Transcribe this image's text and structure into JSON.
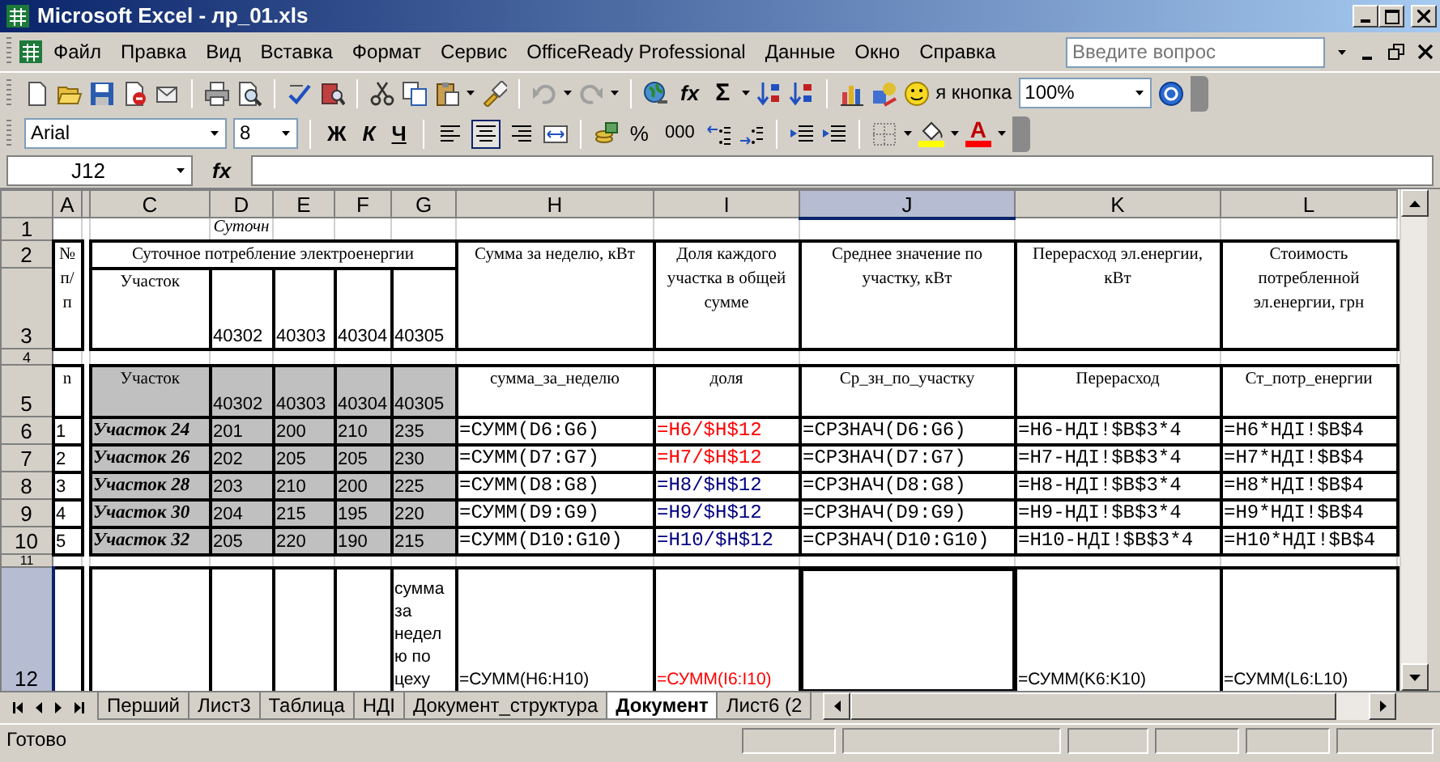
{
  "window": {
    "title": "Microsoft Excel - лр_01.xls"
  },
  "menu": [
    "Файл",
    "Правка",
    "Вид",
    "Вставка",
    "Формат",
    "Сервис",
    "OfficeReady Professional",
    "Данные",
    "Окно",
    "Справка"
  ],
  "help_search": {
    "placeholder": "Введите вопрос"
  },
  "standard_toolbar": {
    "function": "fx",
    "autosum": "Σ",
    "custom_button": "я кнопка",
    "zoom": "100%"
  },
  "formatting_toolbar": {
    "font": "Arial",
    "size": "8",
    "buttons": [
      {
        "label": "Ж",
        "kind": "bold"
      },
      {
        "label": "К",
        "kind": "italic"
      },
      {
        "label": "Ч",
        "kind": "underline"
      }
    ],
    "alignment": [
      {
        "kind": "left",
        "selected": false
      },
      {
        "kind": "center",
        "selected": true
      },
      {
        "kind": "right",
        "selected": false
      }
    ],
    "percent": "%",
    "thousands": "000",
    "font_color": "A"
  },
  "formula_bar": {
    "name_box": "J12",
    "fx": "fx"
  },
  "columns": [
    {
      "label": "A",
      "selected": false
    },
    {
      "selected": false
    },
    {
      "label": "C",
      "selected": false
    },
    {
      "label": "D",
      "selected": false
    },
    {
      "label": "E",
      "selected": false
    },
    {
      "label": "F",
      "selected": false
    },
    {
      "label": "G",
      "selected": false
    },
    {
      "label": "H",
      "selected": false
    },
    {
      "label": "I",
      "selected": false
    },
    {
      "label": "J",
      "selected": true
    },
    {
      "label": "K",
      "selected": false
    },
    {
      "label": "L",
      "selected": false
    }
  ],
  "rows": [
    {
      "header": "1",
      "selected": false,
      "cells": {
        "D": {
          "text": "Суточн",
          "kind": "caption",
          "italic": true
        }
      }
    },
    {
      "header": "2",
      "selected": false,
      "cells": {
        "A": {
          "text": "№ п/п",
          "kind": "caption"
        },
        "C": {
          "text": "Суточное потребление электроенергии",
          "kind": "caption"
        },
        "H": {
          "text": "Сумма за неделю, кВт",
          "kind": "caption"
        },
        "I": {
          "text": "Доля каждого участка в общей сумме",
          "kind": "caption"
        },
        "J": {
          "text": "Среднее значение по участку,  кВт",
          "kind": "caption"
        },
        "K": {
          "text": "Перерасход эл.енергии, кВт",
          "kind": "caption"
        },
        "L": {
          "text": "Стоимость потребленной эл.енергии, грн",
          "kind": "caption"
        }
      }
    },
    {
      "header": "3",
      "selected": false,
      "cells": {
        "C": {
          "text": "Участок",
          "kind": "caption"
        },
        "D": {
          "text": "40302",
          "kind": "number"
        },
        "E": {
          "text": "40303",
          "kind": "number"
        },
        "F": {
          "text": "40304",
          "kind": "number"
        },
        "G": {
          "text": "40305",
          "kind": "number"
        }
      }
    },
    {
      "header": "4",
      "selected": false
    },
    {
      "header": "5",
      "selected": false,
      "cells": {
        "A": {
          "text": "n",
          "kind": "caption",
          "shaded": false
        },
        "C": {
          "text": "Участок",
          "kind": "caption",
          "shaded": true
        },
        "D": {
          "text": "40302",
          "kind": "number",
          "shaded": true
        },
        "E": {
          "text": "40303",
          "kind": "number",
          "shaded": true
        },
        "F": {
          "text": "40304",
          "kind": "number",
          "shaded": true
        },
        "G": {
          "text": "40305",
          "kind": "number",
          "shaded": true
        },
        "H": {
          "text": "сумма_за_неделю",
          "kind": "caption",
          "shaded": false
        },
        "I": {
          "text": "доля",
          "kind": "caption",
          "shaded": false
        },
        "J": {
          "text": "Ср_зн_по_участку",
          "kind": "caption",
          "shaded": false
        },
        "K": {
          "text": "Перерасход",
          "kind": "caption",
          "shaded": false
        },
        "L": {
          "text": "Ст_потр_енергии",
          "kind": "caption",
          "shaded": false
        }
      }
    },
    {
      "header": "6",
      "selected": false,
      "cells": {
        "A": {
          "text": "1",
          "kind": "number",
          "shaded": false
        },
        "C": {
          "text": "Участок 24",
          "kind": "label",
          "italic": true,
          "shaded": true
        },
        "D": {
          "text": "201",
          "kind": "number",
          "shaded": true
        },
        "E": {
          "text": "200",
          "kind": "number",
          "shaded": true
        },
        "F": {
          "text": "210",
          "kind": "number",
          "shaded": true
        },
        "G": {
          "text": "235",
          "kind": "number",
          "shaded": true
        },
        "H": {
          "text": "=СУММ(D6:G6)",
          "kind": "formula",
          "shaded": false
        },
        "I": {
          "text": "=H6/$H$12",
          "kind": "formula",
          "color": "#ff0000",
          "shaded": false
        },
        "J": {
          "text": "=СРЗНАЧ(D6:G6)",
          "kind": "formula",
          "shaded": false
        },
        "K": {
          "text": "=H6-НДІ!$B$3*4",
          "kind": "formula",
          "shaded": false
        },
        "L": {
          "text": "=H6*НДІ!$B$4",
          "kind": "formula",
          "shaded": false
        }
      }
    },
    {
      "header": "7",
      "selected": false,
      "cells": {
        "A": {
          "text": "2",
          "kind": "number",
          "shaded": false
        },
        "C": {
          "text": "Участок 26",
          "kind": "label",
          "italic": true,
          "shaded": true
        },
        "D": {
          "text": "202",
          "kind": "number",
          "shaded": true
        },
        "E": {
          "text": "205",
          "kind": "number",
          "shaded": true
        },
        "F": {
          "text": "205",
          "kind": "number",
          "shaded": true
        },
        "G": {
          "text": "230",
          "kind": "number",
          "shaded": true
        },
        "H": {
          "text": "=СУММ(D7:G7)",
          "kind": "formula",
          "shaded": false
        },
        "I": {
          "text": "=H7/$H$12",
          "kind": "formula",
          "color": "#ff0000",
          "shaded": false
        },
        "J": {
          "text": "=СРЗНАЧ(D7:G7)",
          "kind": "formula",
          "shaded": false
        },
        "K": {
          "text": "=H7-НДІ!$B$3*4",
          "kind": "formula",
          "shaded": false
        },
        "L": {
          "text": "=H7*НДІ!$B$4",
          "kind": "formula",
          "shaded": false
        }
      }
    },
    {
      "header": "8",
      "selected": false,
      "cells": {
        "A": {
          "text": "3",
          "kind": "number",
          "shaded": false
        },
        "C": {
          "text": "Участок 28",
          "kind": "label",
          "italic": true,
          "shaded": true
        },
        "D": {
          "text": "203",
          "kind": "number",
          "shaded": true
        },
        "E": {
          "text": "210",
          "kind": "number",
          "shaded": true
        },
        "F": {
          "text": "200",
          "kind": "number",
          "shaded": true
        },
        "G": {
          "text": "225",
          "kind": "number",
          "shaded": true
        },
        "H": {
          "text": "=СУММ(D8:G8)",
          "kind": "formula",
          "shaded": false
        },
        "I": {
          "text": "=H8/$H$12",
          "kind": "formula",
          "color": "#000080",
          "shaded": false
        },
        "J": {
          "text": "=СРЗНАЧ(D8:G8)",
          "kind": "formula",
          "shaded": false
        },
        "K": {
          "text": "=H8-НДІ!$B$3*4",
          "kind": "formula",
          "shaded": false
        },
        "L": {
          "text": "=H8*НДІ!$B$4",
          "kind": "formula",
          "shaded": false
        }
      }
    },
    {
      "header": "9",
      "selected": false,
      "cells": {
        "A": {
          "text": "4",
          "kind": "number",
          "shaded": false
        },
        "C": {
          "text": "Участок 30",
          "kind": "label",
          "italic": true,
          "shaded": true
        },
        "D": {
          "text": "204",
          "kind": "number",
          "shaded": true
        },
        "E": {
          "text": "215",
          "kind": "number",
          "shaded": true
        },
        "F": {
          "text": "195",
          "kind": "number",
          "shaded": true
        },
        "G": {
          "text": "220",
          "kind": "number",
          "shaded": true
        },
        "H": {
          "text": "=СУММ(D9:G9)",
          "kind": "formula",
          "shaded": false
        },
        "I": {
          "text": "=H9/$H$12",
          "kind": "formula",
          "color": "#000080",
          "shaded": false
        },
        "J": {
          "text": "=СРЗНАЧ(D9:G9)",
          "kind": "formula",
          "shaded": false
        },
        "K": {
          "text": "=H9-НДІ!$B$3*4",
          "kind": "formula",
          "shaded": false
        },
        "L": {
          "text": "=H9*НДІ!$B$4",
          "kind": "formula",
          "shaded": false
        }
      }
    },
    {
      "header": "10",
      "selected": false,
      "cells": {
        "A": {
          "text": "5",
          "kind": "number",
          "shaded": false
        },
        "C": {
          "text": "Участок 32",
          "kind": "label",
          "italic": true,
          "shaded": true
        },
        "D": {
          "text": "205",
          "kind": "number",
          "shaded": true
        },
        "E": {
          "text": "220",
          "kind": "number",
          "shaded": true
        },
        "F": {
          "text": "190",
          "kind": "number",
          "shaded": true
        },
        "G": {
          "text": "215",
          "kind": "number",
          "shaded": true
        },
        "H": {
          "text": "=СУММ(D10:G10)",
          "kind": "formula",
          "shaded": false
        },
        "I": {
          "text": "=H10/$H$12",
          "kind": "formula",
          "color": "#000080",
          "shaded": false
        },
        "J": {
          "text": "=СРЗНАЧ(D10:G10)",
          "kind": "formula",
          "shaded": false
        },
        "K": {
          "text": "=H10-НДІ!$B$3*4",
          "kind": "formula",
          "shaded": false
        },
        "L": {
          "text": "=H10*НДІ!$B$4",
          "kind": "formula",
          "shaded": false
        }
      }
    },
    {
      "header": "11",
      "selected": false
    },
    {
      "header": "12",
      "selected": true,
      "cells": {
        "G": {
          "text": "сумма за неделю по цеху",
          "kind": "text"
        },
        "H": {
          "text": "=СУММ(H6:H10)",
          "kind": "text"
        },
        "I": {
          "text": "=СУММ(I6:I10)",
          "kind": "text",
          "color": "#ff0000"
        },
        "K": {
          "text": "=СУММ(K6:K10)",
          "kind": "text"
        },
        "L": {
          "text": "=СУММ(L6:L10)",
          "kind": "text"
        }
      }
    }
  ],
  "sheet_tabs": [
    {
      "label": "Перший",
      "selected": false
    },
    {
      "label": "Лист3",
      "selected": false
    },
    {
      "label": "Таблица",
      "selected": false
    },
    {
      "label": "НДІ",
      "selected": false
    },
    {
      "label": "Документ_структура",
      "selected": false
    },
    {
      "label": "Документ",
      "selected": true
    },
    {
      "label": "Лист6 (2",
      "selected": false
    }
  ],
  "status_bar": {
    "text": "Готово"
  }
}
